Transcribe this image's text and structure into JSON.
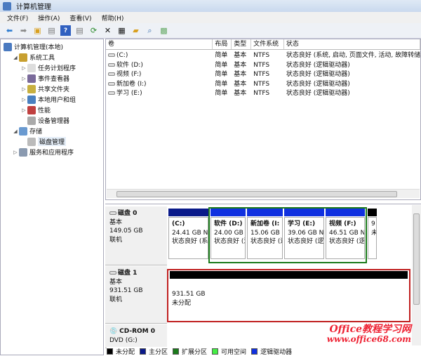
{
  "window": {
    "title": "计算机管理"
  },
  "menu": [
    "文件(F)",
    "操作(A)",
    "查看(V)",
    "帮助(H)"
  ],
  "tree": [
    {
      "label": "计算机管理(本地)",
      "level": 0,
      "exp": ""
    },
    {
      "label": "系统工具",
      "level": 1,
      "exp": "◢"
    },
    {
      "label": "任务计划程序",
      "level": 2,
      "exp": "▷"
    },
    {
      "label": "事件查看器",
      "level": 2,
      "exp": "▷"
    },
    {
      "label": "共享文件夹",
      "level": 2,
      "exp": "▷"
    },
    {
      "label": "本地用户和组",
      "level": 2,
      "exp": "▷"
    },
    {
      "label": "性能",
      "level": 2,
      "exp": "▷"
    },
    {
      "label": "设备管理器",
      "level": 2,
      "exp": ""
    },
    {
      "label": "存储",
      "level": 1,
      "exp": "◢"
    },
    {
      "label": "磁盘管理",
      "level": 2,
      "exp": "",
      "selected": true
    },
    {
      "label": "服务和应用程序",
      "level": 1,
      "exp": "▷"
    }
  ],
  "volumes": {
    "headers": [
      "卷",
      "布局",
      "类型",
      "文件系统",
      "状态"
    ],
    "rows": [
      [
        "(C:)",
        "简单",
        "基本",
        "NTFS",
        "状态良好 (系统, 启动, 页面文件, 活动, 故障转储"
      ],
      [
        "软件 (D:)",
        "简单",
        "基本",
        "NTFS",
        "状态良好 (逻辑驱动器)"
      ],
      [
        "视频 (F:)",
        "简单",
        "基本",
        "NTFS",
        "状态良好 (逻辑驱动器)"
      ],
      [
        "新加卷 (I:)",
        "简单",
        "基本",
        "NTFS",
        "状态良好 (逻辑驱动器)"
      ],
      [
        "学习 (E:)",
        "简单",
        "基本",
        "NTFS",
        "状态良好 (逻辑驱动器)"
      ]
    ]
  },
  "disks": [
    {
      "name": "磁盘 0",
      "type": "基本",
      "size": "149.05 GB",
      "status": "联机",
      "partitions": [
        {
          "name": "(C:)",
          "size": "24.41 GB N",
          "state": "状态良好 (系"
        },
        {
          "name": "软件 (D:)",
          "size": "24.00 GB",
          "state": "状态良好 (逻"
        },
        {
          "name": "新加卷 (I:",
          "size": "15.06 GB",
          "state": "状态良好 (逻"
        },
        {
          "name": "学习 (E:)",
          "size": "39.06 GB N",
          "state": "状态良好 (逻"
        },
        {
          "name": "视频 (F:)",
          "size": "46.51 GB N",
          "state": "状态良好 (逻"
        },
        {
          "name": "",
          "size": "9",
          "state": "未"
        }
      ]
    },
    {
      "name": "磁盘 1",
      "type": "基本",
      "size": "931.51 GB",
      "status": "联机",
      "partitions": [
        {
          "size": "931.51 GB",
          "state": "未分配"
        }
      ]
    },
    {
      "name": "CD-ROM 0",
      "type": "DVD (G:)"
    }
  ],
  "legend": [
    {
      "label": "未分配",
      "color": "#000000"
    },
    {
      "label": "主分区",
      "color": "#0a1a8a"
    },
    {
      "label": "扩展分区",
      "color": "#1a7a1a"
    },
    {
      "label": "可用空间",
      "color": "#44ee44"
    },
    {
      "label": "逻辑驱动器",
      "color": "#1030e0"
    }
  ],
  "watermark": {
    "line1": "Office教程学习网",
    "line2": "www.office68.com"
  }
}
